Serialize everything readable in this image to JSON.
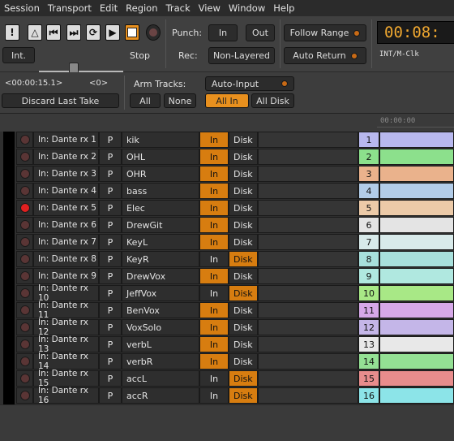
{
  "menu": [
    "Session",
    "Transport",
    "Edit",
    "Region",
    "Track",
    "View",
    "Window",
    "Help"
  ],
  "transport": {
    "int_label": "Int.",
    "stop_label": "Stop",
    "punch_label": "Punch:",
    "punch_in": "In",
    "punch_out": "Out",
    "rec_label": "Rec:",
    "rec_mode": "Non-Layered",
    "follow_range": "Follow Range",
    "auto_return": "Auto Return",
    "clock": "00:08:",
    "sync": "INT/M-Clk"
  },
  "edit": {
    "time": "<00:00:15.1>",
    "count": "<0>",
    "discard": "Discard Last Take",
    "arm_label": "Arm Tracks:",
    "all": "All",
    "none": "None",
    "auto_input": "Auto-Input",
    "all_in": "All In",
    "all_disk": "All Disk"
  },
  "ruler": {
    "time": "00:00:00"
  },
  "tracks": [
    {
      "input": "In: Dante rx 1",
      "p": "P",
      "name": "kik",
      "in": "In",
      "disk": "Disk",
      "in_on": true,
      "disk_on": false,
      "num": "1",
      "color": "#b8b8ee",
      "rec": false
    },
    {
      "input": "In: Dante rx 2",
      "p": "P",
      "name": "OHL",
      "in": "In",
      "disk": "Disk",
      "in_on": true,
      "disk_on": false,
      "num": "2",
      "color": "#8ce08c",
      "rec": false
    },
    {
      "input": "In: Dante rx 3",
      "p": "P",
      "name": "OHR",
      "in": "In",
      "disk": "Disk",
      "in_on": true,
      "disk_on": false,
      "num": "3",
      "color": "#eab28c",
      "rec": false
    },
    {
      "input": "In: Dante rx 4",
      "p": "P",
      "name": "bass",
      "in": "In",
      "disk": "Disk",
      "in_on": true,
      "disk_on": false,
      "num": "4",
      "color": "#b2cce8",
      "rec": false
    },
    {
      "input": "In: Dante rx 5",
      "p": "P",
      "name": "Elec",
      "in": "In",
      "disk": "Disk",
      "in_on": true,
      "disk_on": false,
      "num": "5",
      "color": "#eccaa8",
      "rec": true
    },
    {
      "input": "In: Dante rx 6",
      "p": "P",
      "name": "DrewGit",
      "in": "In",
      "disk": "Disk",
      "in_on": true,
      "disk_on": false,
      "num": "6",
      "color": "#e4e4e4",
      "rec": false
    },
    {
      "input": "In: Dante rx 7",
      "p": "P",
      "name": "KeyL",
      "in": "In",
      "disk": "Disk",
      "in_on": true,
      "disk_on": false,
      "num": "7",
      "color": "#d8eaea",
      "rec": false
    },
    {
      "input": "In: Dante rx 8",
      "p": "P",
      "name": "KeyR",
      "in": "In",
      "disk": "Disk",
      "in_on": false,
      "disk_on": true,
      "num": "8",
      "color": "#a8e0dc",
      "rec": false
    },
    {
      "input": "In: Dante rx 9",
      "p": "P",
      "name": "DrewVox",
      "in": "In",
      "disk": "Disk",
      "in_on": true,
      "disk_on": false,
      "num": "9",
      "color": "#b0e8e0",
      "rec": false
    },
    {
      "input": "In: Dante rx 10",
      "p": "P",
      "name": "JeffVox",
      "in": "In",
      "disk": "Disk",
      "in_on": false,
      "disk_on": true,
      "num": "10",
      "color": "#a8e886",
      "rec": false
    },
    {
      "input": "In: Dante rx 11",
      "p": "P",
      "name": "BenVox",
      "in": "In",
      "disk": "Disk",
      "in_on": true,
      "disk_on": false,
      "num": "11",
      "color": "#d6a8e8",
      "rec": false
    },
    {
      "input": "In: Dante rx 12",
      "p": "P",
      "name": "VoxSolo",
      "in": "In",
      "disk": "Disk",
      "in_on": true,
      "disk_on": false,
      "num": "12",
      "color": "#c4b6e8",
      "rec": false
    },
    {
      "input": "In: Dante rx 13",
      "p": "P",
      "name": "verbL",
      "in": "In",
      "disk": "Disk",
      "in_on": true,
      "disk_on": false,
      "num": "13",
      "color": "#e8e8e8",
      "rec": false
    },
    {
      "input": "In: Dante rx 14",
      "p": "P",
      "name": "verbR",
      "in": "In",
      "disk": "Disk",
      "in_on": true,
      "disk_on": false,
      "num": "14",
      "color": "#94e094",
      "rec": false
    },
    {
      "input": "In: Dante rx 15",
      "p": "P",
      "name": "accL",
      "in": "In",
      "disk": "Disk",
      "in_on": false,
      "disk_on": true,
      "num": "15",
      "color": "#e88c8c",
      "rec": false
    },
    {
      "input": "In: Dante rx 16",
      "p": "P",
      "name": "accR",
      "in": "In",
      "disk": "Disk",
      "in_on": false,
      "disk_on": true,
      "num": "16",
      "color": "#8ce4e8",
      "rec": false
    }
  ]
}
